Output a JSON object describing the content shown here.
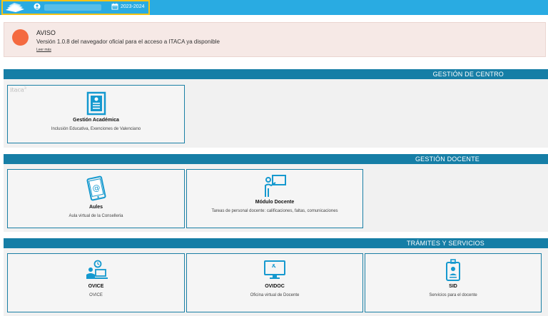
{
  "topbar": {
    "academic_year": "2023-2024",
    "accent": "#29abe2",
    "highlight": "#f3c316"
  },
  "notice": {
    "title": "AVISO",
    "text": "Versión 1.0.8 del navegador oficial para el acceso a ITACA ya disponible",
    "link": "Leer más"
  },
  "sections": [
    {
      "title": "GESTIÓN DE CENTRO",
      "cards": [
        {
          "title": "Gestión Académica",
          "subtitle": "Inclusión Educativa, Exenciones de Valenciano",
          "brand": "itaca",
          "brand_sup": "3",
          "icon": "document-icon"
        }
      ]
    },
    {
      "title": "GESTIÓN DOCENTE",
      "cards": [
        {
          "title": "Aules",
          "subtitle": "Aula virtual de la Conselleria",
          "icon": "tablet-at-icon"
        },
        {
          "title": "Módulo Docente",
          "subtitle": "Tareas de personal docente: calificaciones, faltas, comunicaciones",
          "icon": "teacher-board-icon"
        }
      ]
    },
    {
      "title": "TRÁMITES Y SERVICIOS",
      "cards": [
        {
          "title": "OVICE",
          "subtitle": "OVICE",
          "icon": "person-clock-icon"
        },
        {
          "title": "OVIDOC",
          "subtitle": "Oficina virtual de Docente",
          "icon": "monitor-icon"
        },
        {
          "title": "SID",
          "subtitle": "Servicios para el docente",
          "icon": "id-badge-icon"
        }
      ]
    }
  ]
}
